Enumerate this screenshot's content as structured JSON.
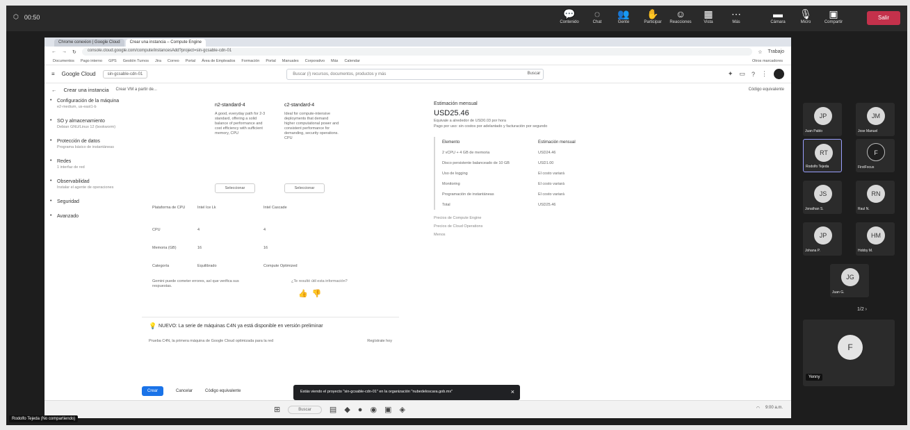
{
  "meeting": {
    "timer": "00:50",
    "toolbar": [
      {
        "name": "chat-icon",
        "label": "Contenido",
        "glyph": "💬"
      },
      {
        "name": "chat-icon",
        "label": "Chat",
        "glyph": "◌"
      },
      {
        "name": "people-icon",
        "label": "Gente",
        "glyph": "👥"
      },
      {
        "name": "raise-hand-icon",
        "label": "Participar",
        "glyph": "✋"
      },
      {
        "name": "reactions-icon",
        "label": "Reacciones",
        "glyph": "☺"
      },
      {
        "name": "view-icon",
        "label": "Vista",
        "glyph": "▦"
      },
      {
        "name": "more-icon",
        "label": "Más",
        "glyph": "⋯"
      },
      {
        "name": "camera-icon",
        "label": "Cámara",
        "glyph": "▬"
      },
      {
        "name": "mic-icon",
        "label": "Micro",
        "glyph": "🎙"
      },
      {
        "name": "share-icon",
        "label": "Compartir",
        "glyph": "▣"
      }
    ],
    "leave_label": "Salir",
    "presenter_label": "Rodolfo Tejeda (No compartiendo)",
    "pager": "1/2 ›"
  },
  "browser": {
    "tabs": [
      "Chrome conexion | Google Cloud",
      "Crear una instancia – Compute Engine"
    ],
    "url": "console.cloud.google.com/compute/instancesAdd?project=sin-gcsable-cdn-01",
    "profile_label": "Trabajo",
    "bookmarks": [
      "Documentos",
      "Pago interno",
      "GPS",
      "Gestión Turnos",
      "Jira",
      "Correo",
      "Portal",
      "Área de Empleados",
      "Formación",
      "Portal",
      "Manuales",
      "Corporativo",
      "Más",
      "Calendar"
    ],
    "bookmarks_right": "Otros marcadores"
  },
  "gcloud": {
    "brand": "Google Cloud",
    "project": "sin-gcsable-cdn-01",
    "search_placeholder": "Buscar (/) recursos, documentos, productos y más",
    "search_button": "Buscar",
    "page_title": "Crear una instancia",
    "page_sub": "Crear VM a partir de...",
    "code_link": "Código equivalente"
  },
  "sidebar": [
    {
      "label": "Configuración de la máquina",
      "sub": "e2-medium, us-east1-b"
    },
    {
      "label": "SO y almacenamiento",
      "sub": "Debian GNU/Linux 12 (bookworm)"
    },
    {
      "label": "Protección de datos",
      "sub": "Programa básico de instantáneas"
    },
    {
      "label": "Redes",
      "sub": "1 interfaz de red"
    },
    {
      "label": "Observabilidad",
      "sub": "Instalar el agente de operaciones"
    },
    {
      "label": "Seguridad",
      "sub": ""
    },
    {
      "label": "Avanzado",
      "sub": ""
    }
  ],
  "comparison": {
    "machines": [
      {
        "name": "n2-standard-4",
        "desc": "A good, everyday path for 2-3 standard, offering a solid balance of performance and cost efficiency with sufficient memory, CPU",
        "select": "Seleccionar"
      },
      {
        "name": "c2-standard-4",
        "desc": "Ideal for compute-intensive deployments that demand higher computational power and consistent performance for demanding, security operations. CPU",
        "select": "Seleccionar"
      }
    ],
    "rows": [
      {
        "label": "Plataforma de CPU",
        "a": "Intel Ice Lk",
        "b": "Intel Cascade"
      },
      {
        "label": "CPU",
        "a": "4",
        "b": "4"
      },
      {
        "label": "Memoria (GB)",
        "a": "16",
        "b": "16"
      },
      {
        "label": "Categoría",
        "a": "Equilibrado",
        "b": "Compute Optimized"
      }
    ],
    "note": "Gemini puede cometer errores, así que verifica sus respuestas.",
    "feedback_q": "¿Te resultó útil esta información?"
  },
  "estimate": {
    "heading": "Estimación mensual",
    "price": "USD25.46",
    "sub": "Equivale a alrededor de USD0.03 por hora",
    "hint": "Pago por uso: sin costos por adelantado y facturación por segundo",
    "table_head": {
      "item": "Elemento",
      "cost": "Estimación mensual"
    },
    "rows": [
      {
        "item": "2 vCPU + 4 GB de memoria",
        "cost": "USD24.46"
      },
      {
        "item": "Disco persistente balanceado de 10 GB",
        "cost": "USD1.00"
      },
      {
        "item": "Uso de logging",
        "cost": "El costo variará"
      },
      {
        "item": "Monitoring",
        "cost": "El costo variará"
      },
      {
        "item": "Programación de instantáneas",
        "cost": "El costo variará"
      },
      {
        "item": "Total",
        "cost": "USD25.46"
      }
    ],
    "links": [
      "Precios de Compute Engine",
      "Precios de Cloud Operations",
      "Menos"
    ]
  },
  "banner": {
    "text": "NUEVO: La serie de máquinas C4N ya está disponible en versión preliminar",
    "link": "Prueba C4N, la primera máquina de Google Cloud optimizada para la red",
    "link_right": "Regístrate hoy"
  },
  "actions": {
    "create": "Crear",
    "cancel": "Cancelar",
    "code": "Código equivalente"
  },
  "toast": "Estás viendo el proyecto \"sin-gcsable-cdn-01\" en la organización \"nubedeloscara.gob.mx\"",
  "taskbar": {
    "search": "Buscar",
    "tray": "9:00 a.m."
  },
  "participants": [
    {
      "initials": "JP",
      "name": "Juan Pablo",
      "dark": false,
      "selected": false
    },
    {
      "initials": "JM",
      "name": "Jose Manuel",
      "dark": false,
      "selected": false
    },
    {
      "initials": "RT",
      "name": "Rodolfo Tejeda",
      "dark": false,
      "selected": true
    },
    {
      "initials": "F",
      "name": "FirstFocus",
      "dark": true,
      "selected": false
    },
    {
      "initials": "JS",
      "name": "Jonathan S.",
      "dark": false,
      "selected": false
    },
    {
      "initials": "RN",
      "name": "Raul N.",
      "dark": false,
      "selected": false
    },
    {
      "initials": "JP",
      "name": "Johana P.",
      "dark": false,
      "selected": false
    },
    {
      "initials": "HM",
      "name": "Hobby M.",
      "dark": false,
      "selected": false
    },
    {
      "initials": "JG",
      "name": "Juan G.",
      "dark": false,
      "selected": false
    }
  ],
  "self": {
    "initials": "F",
    "name": "Yenny"
  }
}
